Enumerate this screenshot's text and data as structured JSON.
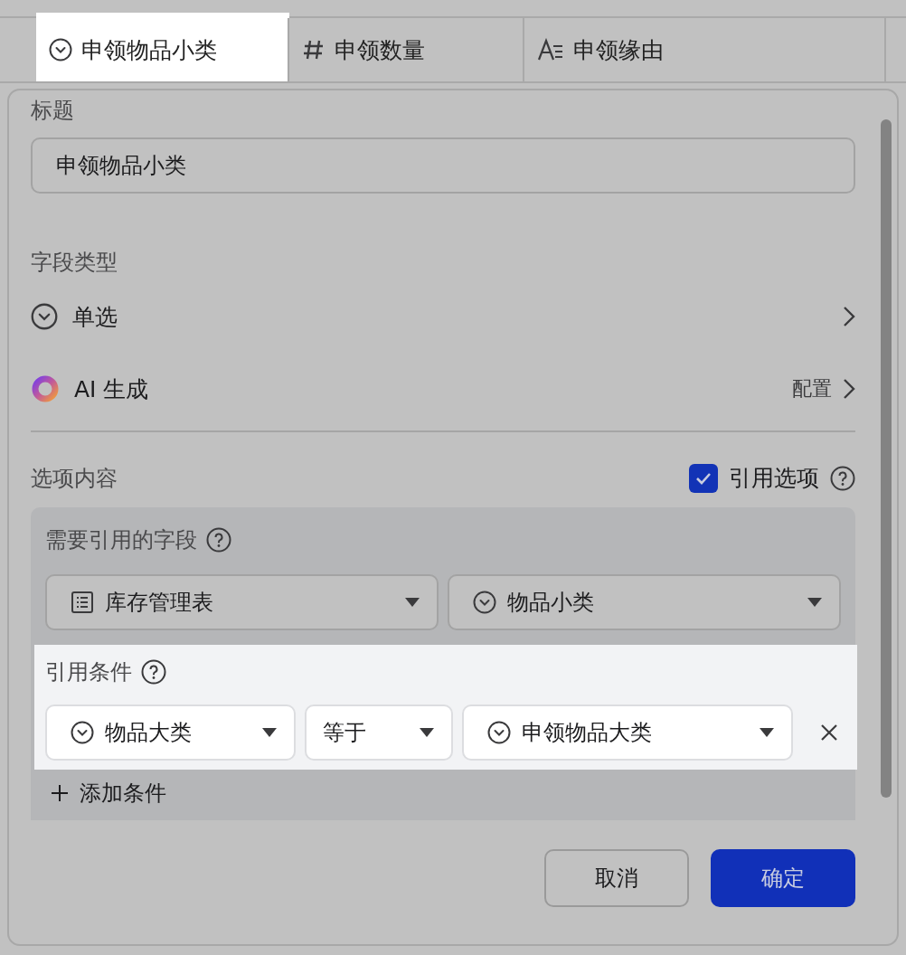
{
  "header": {
    "columns": [
      {
        "kind": "select",
        "label": "申领物品小类",
        "highlighted": true
      },
      {
        "kind": "number",
        "label": "申领数量",
        "highlighted": false
      },
      {
        "kind": "text",
        "label": "申领缘由",
        "highlighted": false
      }
    ]
  },
  "form": {
    "title_label": "标题",
    "title_value": "申领物品小类",
    "field_type_label": "字段类型",
    "field_type": "单选",
    "ai": {
      "label": "AI 生成",
      "action": "配置"
    },
    "options_label": "选项内容",
    "reference_option": {
      "label": "引用选项",
      "checked": true
    },
    "reference_block": {
      "field_label": "需要引用的字段",
      "table": "库存管理表",
      "field": "物品小类",
      "conditions_label": "引用条件",
      "conditions_highlighted": true,
      "condition": {
        "field": "物品大类",
        "operator": "等于",
        "value": "申领物品大类"
      },
      "add_label": "添加条件"
    }
  },
  "buttons": {
    "cancel": "取消",
    "confirm": "确定"
  }
}
